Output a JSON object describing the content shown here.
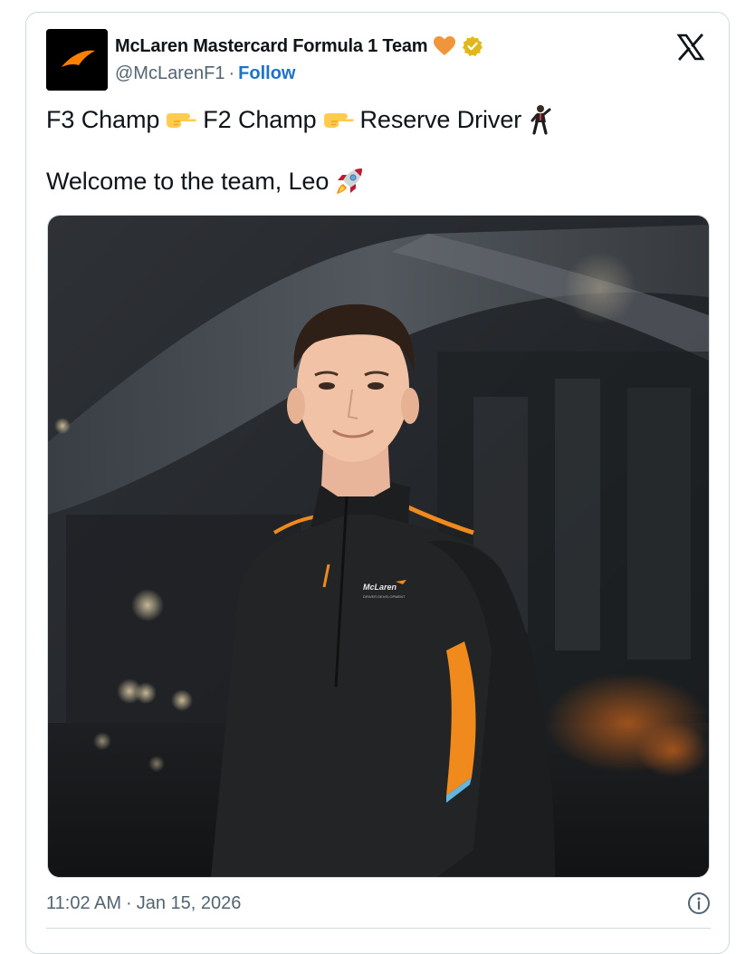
{
  "author": {
    "name": "McLaren Mastercard Formula 1 Team",
    "handle": "@McLarenF1",
    "separator": "·",
    "follow_label": "Follow",
    "heart_icon": "orange-heart-icon",
    "verified_icon": "gold-verified-badge-icon",
    "avatar_icon": "mclaren-speedmark-logo"
  },
  "platform_icon": "x-logo-icon",
  "tweet": {
    "line1_part1": "F3 Champ",
    "line1_part2": "F2 Champ",
    "line1_part3": "Reserve Driver",
    "line1_emojis": [
      "pointing-right-icon",
      "pointing-right-icon",
      "racing-driver-icon"
    ],
    "line2_text": "Welcome to the team, Leo",
    "line2_emoji": "rocket-icon"
  },
  "media": {
    "alt": "Young driver in a black McLaren team quarter-zip with orange stripes, standing in a dim garage",
    "jacket_logo_text": "McLaren",
    "jacket_logo_subtext": "DRIVER DEVELOPMENT"
  },
  "footer": {
    "time": "11:02 AM",
    "separator": "·",
    "date": "Jan 15, 2026",
    "info_icon": "info-icon"
  },
  "colors": {
    "accent_orange": "#ff8000",
    "link_blue": "#1d73c9",
    "muted_text": "#536471",
    "border": "#cfd9de"
  }
}
